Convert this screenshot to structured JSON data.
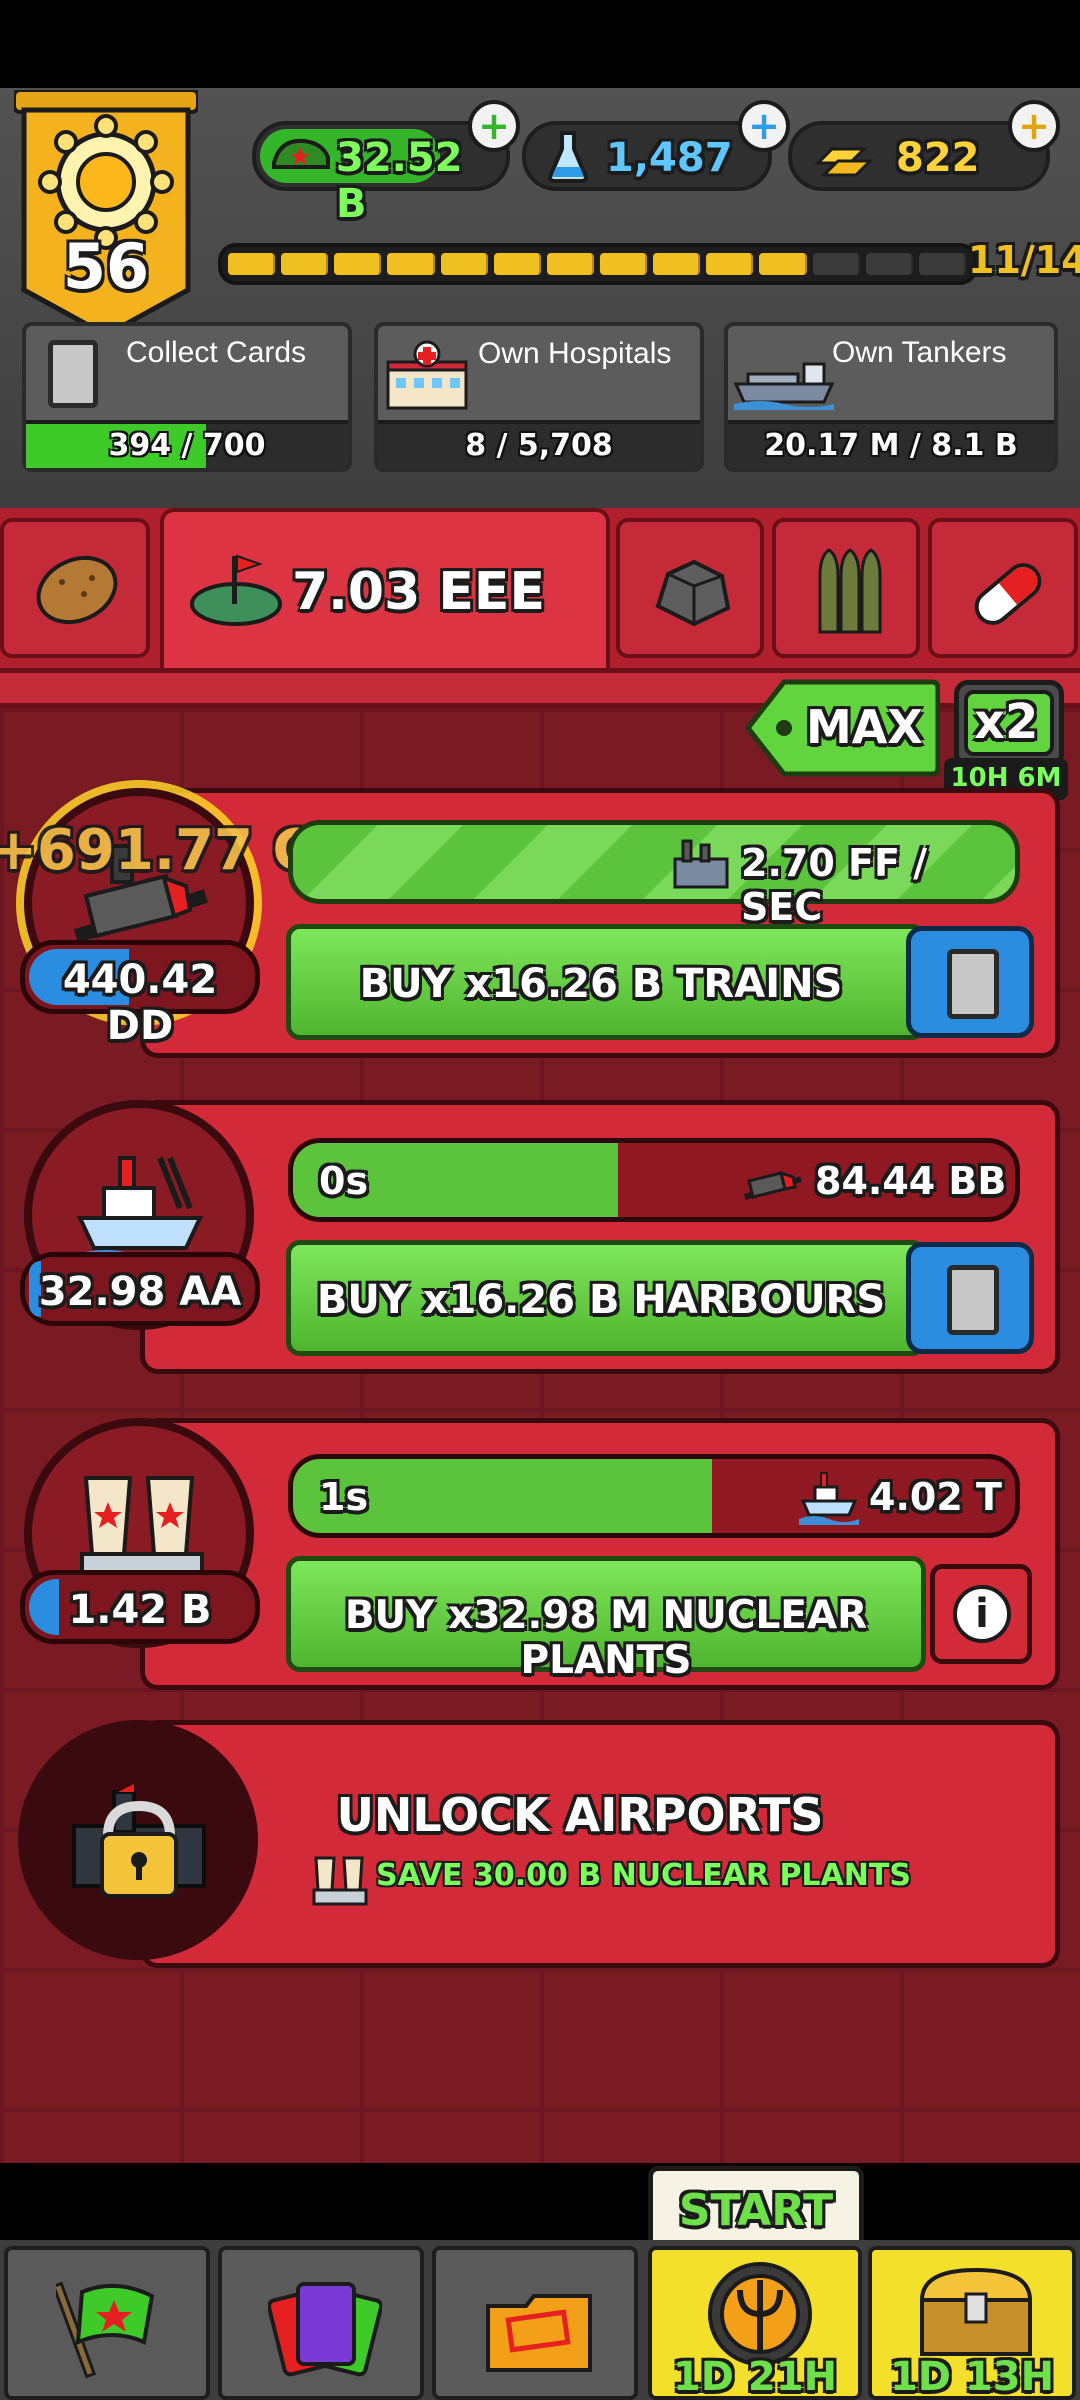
{
  "player": {
    "level": "56"
  },
  "currencies": {
    "cash": "32.52 B",
    "research": "1,487",
    "gold": "822"
  },
  "xp": {
    "progress_text": "11/14",
    "filled_segments": 11,
    "total_segments": 14
  },
  "missions": [
    {
      "label": "Collect Cards",
      "progress": "394 / 700",
      "fraction": 0.56
    },
    {
      "label": "Own Hospitals",
      "progress": "8 / 5,708",
      "fraction": 0.0
    },
    {
      "label": "Own Tankers",
      "progress": "20.17 M / 8.1 B",
      "fraction": 0.0
    }
  ],
  "resource_tabs": {
    "active_value": "7.03 EEE",
    "icons": [
      "potato-icon",
      "land-flag-icon",
      "ore-icon",
      "ammo-icon",
      "pill-icon"
    ]
  },
  "multiplier": {
    "max_label": "MAX",
    "boost_label": "x2",
    "boost_timer": "10H 6M"
  },
  "rows": [
    {
      "name": "trains",
      "floating_gain": "+691.77 CC",
      "owned": "440.42 DD",
      "rate_text": "2.70 FF / SEC",
      "progress_fraction": 1.0,
      "buy_label": "BUY x16.26 B TRAINS"
    },
    {
      "name": "harbours",
      "owned": "32.98 AA",
      "timer": "0s",
      "requirement": "84.44 BB",
      "progress_fraction": 0.45,
      "buy_label": "BUY x16.26 B HARBOURS"
    },
    {
      "name": "nuclear-plants",
      "owned": "1.42 B",
      "timer": "1s",
      "requirement": "4.02 T",
      "progress_fraction": 0.58,
      "buy_label": "BUY x32.98 M NUCLEAR PLANTS",
      "info_label": "i"
    }
  ],
  "unlock": {
    "title": "UNLOCK AIRPORTS",
    "requirement": "SAVE 30.00 B NUCLEAR PLANTS"
  },
  "bottom_nav": {
    "start_label": "START",
    "event_timer_1": "1D 21H",
    "event_timer_2": "1D 13H"
  }
}
